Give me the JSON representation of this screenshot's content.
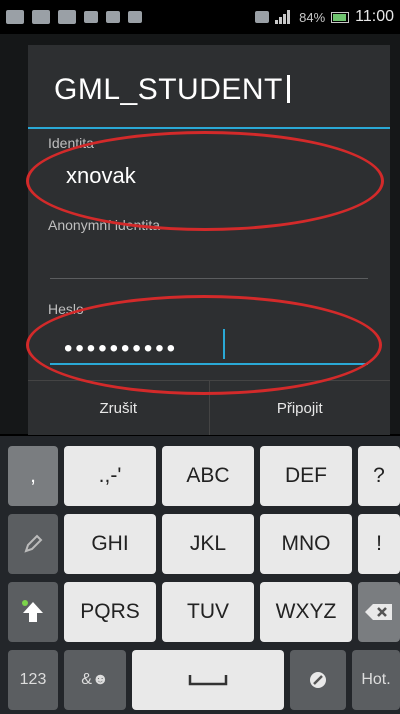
{
  "status_bar": {
    "battery": "84%",
    "time": "11:00",
    "icons": [
      "image-icon",
      "mail-icon",
      "mail-icon",
      "usb-icon",
      "sd-icon",
      "alarm-icon",
      "wifi-icon",
      "signal-icon",
      "battery-icon"
    ]
  },
  "dialog": {
    "title": "GML_STUDENT",
    "identity_label": "Identita",
    "identity_value": "xnovak",
    "anon_identity_label": "Anonymní identita",
    "password_label": "Heslo",
    "password_value": "••••••••••",
    "cancel_label": "Zrušit",
    "connect_label": "Připojit"
  },
  "keyboard": {
    "row1": [
      ",",
      ".,-'",
      "ABC",
      "DEF",
      "?"
    ],
    "row2": [
      "GHI",
      "JKL",
      "MNO",
      "!"
    ],
    "row3": [
      "PQRS",
      "TUV",
      "WXYZ"
    ],
    "row4": [
      "123",
      "&☻",
      "Hot."
    ],
    "pencil_icon": "pencil-icon",
    "shift_icon": "shift-icon",
    "backspace_icon": "backspace-icon",
    "space_icon": "space-icon",
    "settings_icon": "settings-icon"
  },
  "colors": {
    "accent": "#2aa9d6",
    "annotation": "#d32a2a"
  }
}
